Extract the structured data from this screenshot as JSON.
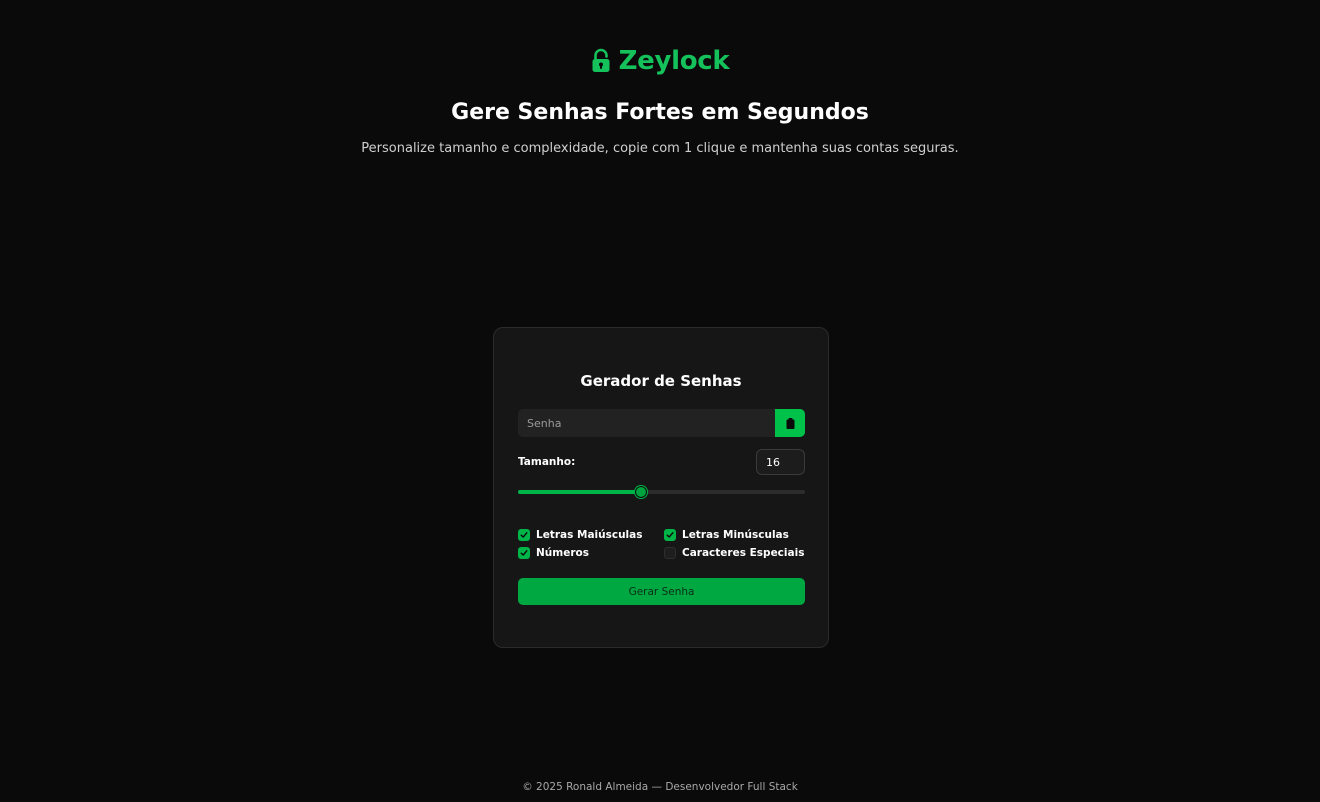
{
  "header": {
    "brand_name": "Zeylock",
    "brand_icon": "lock-icon",
    "headline": "Gere Senhas Fortes em Segundos",
    "subheadline": "Personalize tamanho e complexidade, copie com 1 clique e mantenha suas contas seguras."
  },
  "generator": {
    "title": "Gerador de Senhas",
    "password_value": "",
    "password_placeholder": "Senha",
    "copy_icon": "clipboard-icon",
    "size_label": "Tamanho:",
    "size_value": "16",
    "slider": {
      "value": 16,
      "min": 4,
      "max": 32
    },
    "options": [
      {
        "label": "Letras Maiúsculas",
        "checked": true
      },
      {
        "label": "Letras Minúsculas",
        "checked": true
      },
      {
        "label": "Números",
        "checked": true
      },
      {
        "label": "Caracteres Especiais",
        "checked": false
      }
    ],
    "generate_label": "Gerar Senha"
  },
  "footer": {
    "text": "© 2025 Ronald Almeida — Desenvolvedor Full Stack"
  },
  "colors": {
    "accent": "#00b548",
    "brand": "#14c15a",
    "background": "#0a0a0a",
    "card": "#161616"
  }
}
